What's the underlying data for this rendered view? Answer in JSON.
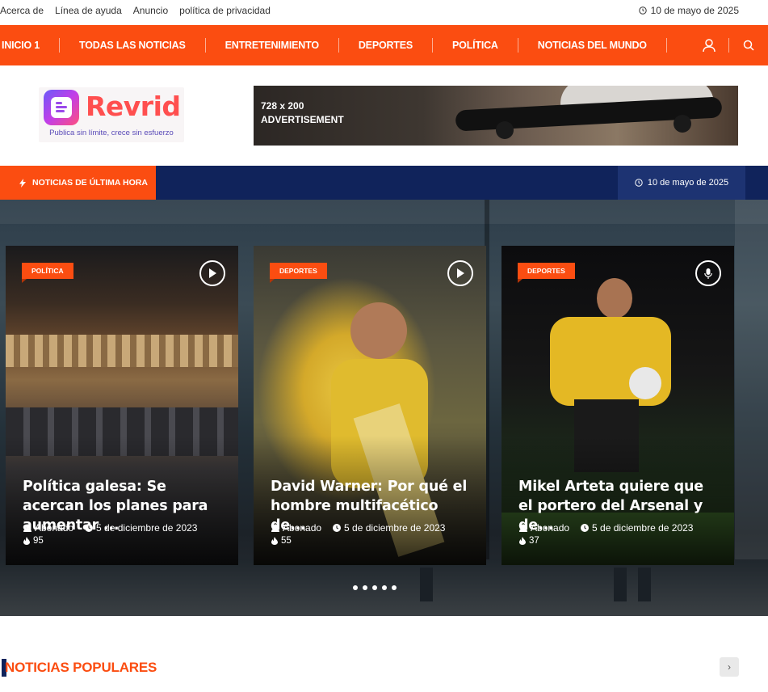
{
  "topbar": {
    "links": [
      "Acerca de",
      "Línea de ayuda",
      "Anuncio",
      "política de privacidad"
    ],
    "date": "10 de mayo de 2025"
  },
  "nav": {
    "items": [
      "INICIO 1",
      "TODAS LAS NOTICIAS",
      "ENTRETENIMIENTO",
      "DEPORTES",
      "POLÍTICA",
      "NOTICIAS DEL MUNDO"
    ],
    "icons": [
      "user-icon",
      "search-icon"
    ]
  },
  "header": {
    "logo_name": "Revrid",
    "logo_tagline": "Publica sin límite, crece sin esfuerzo",
    "ad_line1": "728 x 200",
    "ad_line2": "ADVERTISEMENT"
  },
  "breaking": {
    "label": "NOTICIAS DE ÚLTIMA HORA",
    "date": "10 de mayo de 2025"
  },
  "slider": {
    "cards": [
      {
        "category": "POLÍTICA",
        "title": "Política galesa: Se acercan los planes para aumentar ...",
        "author": "Abonado",
        "date": "5 de diciembre de 2023",
        "views": "95",
        "media_icon": "play-icon"
      },
      {
        "category": "DEPORTES",
        "title": "David Warner: Por qué el hombre multifacético de...",
        "author": "Abonado",
        "date": "5 de diciembre de 2023",
        "views": "55",
        "media_icon": "play-icon"
      },
      {
        "category": "DEPORTES",
        "title": "Mikel Arteta quiere que el portero del Arsenal y de...",
        "author": "Abonado",
        "date": "5 de diciembre de 2023",
        "views": "37",
        "media_icon": "microphone-icon"
      }
    ],
    "dots_count": 5
  },
  "popular": {
    "title": "NOTICIAS POPULARES",
    "next": "›"
  },
  "colors": {
    "accent": "#fb4d11",
    "navy": "#10235b"
  }
}
